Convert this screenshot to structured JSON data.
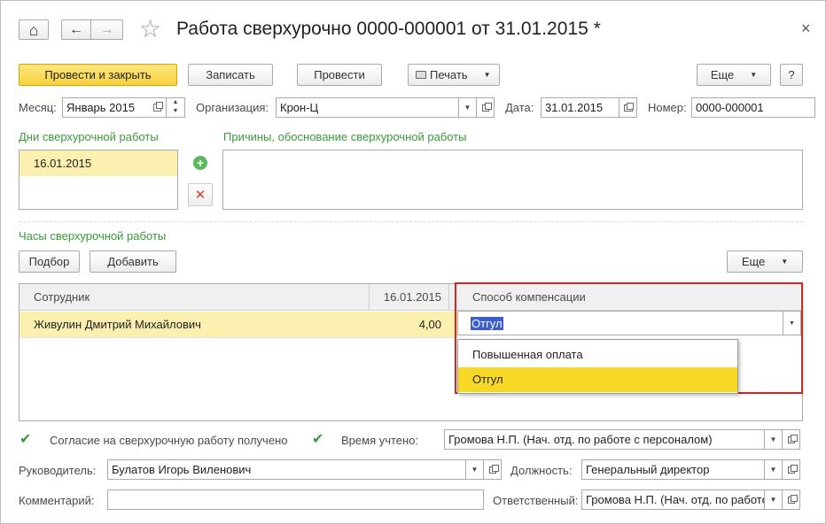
{
  "window": {
    "title": "Работа сверхурочно 0000-000001 от 31.01.2015 *",
    "close_glyph": "×",
    "home_glyph": "⌂",
    "back_glyph": "←",
    "forward_glyph": "→",
    "star_glyph": "☆"
  },
  "toolbar": {
    "post_close": "Провести и закрыть",
    "save": "Записать",
    "post": "Провести",
    "print": "Печать",
    "more": "Еще",
    "help": "?",
    "dd_glyph": "▼"
  },
  "header_fields": {
    "month_label": "Месяц:",
    "month_value": "Январь 2015",
    "org_label": "Организация:",
    "org_value": "Крон-Ц",
    "date_label": "Дата:",
    "date_value": "31.01.2015",
    "number_label": "Номер:",
    "number_value": "0000-000001"
  },
  "days_section": {
    "title": "Дни сверхурочной работы",
    "items": [
      "16.01.2015"
    ],
    "add_glyph": "+",
    "delete_glyph": "✕"
  },
  "reasons_section": {
    "title": "Причины, обоснование сверхурочной работы",
    "value": ""
  },
  "hours_section": {
    "title": "Часы сверхурочной работы",
    "select_btn": "Подбор",
    "add_btn": "Добавить",
    "more_btn": "Еще",
    "columns": [
      "Сотрудник",
      "16.01.2015",
      "Способ компенсации"
    ],
    "rows": [
      {
        "employee": "Живулин Дмитрий Михайлович",
        "hours": "4,00",
        "compensation": "Отгул"
      }
    ],
    "dropdown_options": [
      "Повышенная оплата",
      "Отгул"
    ],
    "selected_option": "Отгул"
  },
  "bottom": {
    "consent_label": "Согласие на сверхурочную работу получено",
    "time_label": "Время учтено:",
    "time_value": "Громова Н.П. (Нач. отд. по работе с персоналом)",
    "head_label": "Руководитель:",
    "head_value": "Булатов Игорь Виленович",
    "position_label": "Должность:",
    "position_value": "Генеральный директор",
    "comment_label": "Комментарий:",
    "comment_value": "",
    "responsible_label": "Ответственный:",
    "responsible_value": "Громова Н.П. (Нач. отд. по работе с персоналом)",
    "check_glyph": "✔"
  },
  "colors": {
    "accent_yellow": "#f7d23b",
    "row_highlight": "#fbf0b0",
    "section_green": "#3b9a3b",
    "focus_red": "#e0201c",
    "selection_blue": "#3a5fcd"
  }
}
